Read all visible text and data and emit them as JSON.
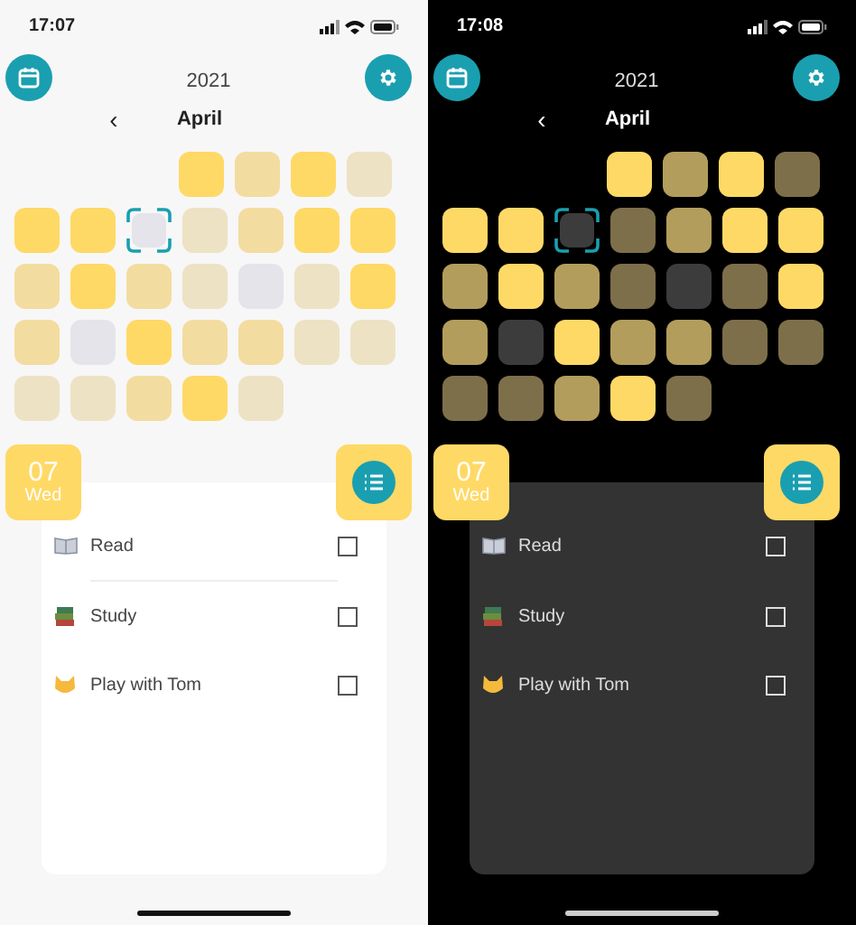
{
  "screens": [
    {
      "kind": "light",
      "status_bar": {
        "time": "17:07"
      },
      "header": {
        "year": "2021",
        "month": "April",
        "prev": "‹"
      },
      "weeks": [
        {
          "days": [
            {
              "kind": "full",
              "selected": false
            },
            {
              "kind": "mid",
              "selected": false
            },
            {
              "kind": "full",
              "selected": false
            },
            {
              "kind": "low",
              "selected": false
            }
          ]
        },
        {
          "days": [
            {
              "kind": "full",
              "selected": false
            },
            {
              "kind": "full",
              "selected": false
            },
            {
              "kind": "empty",
              "selected": true
            },
            {
              "kind": "low",
              "selected": false
            },
            {
              "kind": "mid",
              "selected": false
            },
            {
              "kind": "full",
              "selected": false
            },
            {
              "kind": "full",
              "selected": false
            }
          ]
        },
        {
          "days": [
            {
              "kind": "mid",
              "selected": false
            },
            {
              "kind": "full",
              "selected": false
            },
            {
              "kind": "mid",
              "selected": false
            },
            {
              "kind": "low",
              "selected": false
            },
            {
              "kind": "empty",
              "selected": false
            },
            {
              "kind": "low",
              "selected": false
            },
            {
              "kind": "full",
              "selected": false
            }
          ]
        },
        {
          "days": [
            {
              "kind": "mid",
              "selected": false
            },
            {
              "kind": "empty",
              "selected": false
            },
            {
              "kind": "full",
              "selected": false
            },
            {
              "kind": "mid",
              "selected": false
            },
            {
              "kind": "mid",
              "selected": false
            },
            {
              "kind": "low",
              "selected": false
            },
            {
              "kind": "low",
              "selected": false
            }
          ]
        },
        {
          "days": [
            {
              "kind": "low",
              "selected": false
            },
            {
              "kind": "low",
              "selected": false
            },
            {
              "kind": "mid",
              "selected": false
            },
            {
              "kind": "full",
              "selected": false
            },
            {
              "kind": "low",
              "selected": false
            }
          ]
        }
      ],
      "date_badge": {
        "day": "07",
        "weekday": "Wed"
      },
      "tasks": [
        {
          "kind": "book",
          "label": "Read",
          "checked": false
        },
        {
          "kind": "books",
          "label": "Study",
          "checked": false
        },
        {
          "kind": "cat",
          "label": "Play with Tom",
          "checked": false
        }
      ]
    },
    {
      "kind": "dark",
      "status_bar": {
        "time": "17:08"
      },
      "header": {
        "year": "2021",
        "month": "April",
        "prev": "‹"
      },
      "weeks": [
        {
          "days": [
            {
              "kind": "full",
              "selected": false
            },
            {
              "kind": "mid",
              "selected": false
            },
            {
              "kind": "full",
              "selected": false
            },
            {
              "kind": "low",
              "selected": false
            }
          ]
        },
        {
          "days": [
            {
              "kind": "full",
              "selected": false
            },
            {
              "kind": "full",
              "selected": false
            },
            {
              "kind": "empty",
              "selected": true
            },
            {
              "kind": "low",
              "selected": false
            },
            {
              "kind": "mid",
              "selected": false
            },
            {
              "kind": "full",
              "selected": false
            },
            {
              "kind": "full",
              "selected": false
            }
          ]
        },
        {
          "days": [
            {
              "kind": "mid",
              "selected": false
            },
            {
              "kind": "full",
              "selected": false
            },
            {
              "kind": "mid",
              "selected": false
            },
            {
              "kind": "low",
              "selected": false
            },
            {
              "kind": "empty",
              "selected": false
            },
            {
              "kind": "low",
              "selected": false
            },
            {
              "kind": "full",
              "selected": false
            }
          ]
        },
        {
          "days": [
            {
              "kind": "mid",
              "selected": false
            },
            {
              "kind": "empty",
              "selected": false
            },
            {
              "kind": "full",
              "selected": false
            },
            {
              "kind": "mid",
              "selected": false
            },
            {
              "kind": "mid",
              "selected": false
            },
            {
              "kind": "low",
              "selected": false
            },
            {
              "kind": "low",
              "selected": false
            }
          ]
        },
        {
          "days": [
            {
              "kind": "low",
              "selected": false
            },
            {
              "kind": "low",
              "selected": false
            },
            {
              "kind": "mid",
              "selected": false
            },
            {
              "kind": "full",
              "selected": false
            },
            {
              "kind": "low",
              "selected": false
            }
          ]
        }
      ],
      "date_badge": {
        "day": "07",
        "weekday": "Wed"
      },
      "tasks": [
        {
          "kind": "book",
          "label": "Read",
          "checked": false
        },
        {
          "kind": "books",
          "label": "Study",
          "checked": false
        },
        {
          "kind": "cat",
          "label": "Play with Tom",
          "checked": false
        }
      ]
    }
  ]
}
